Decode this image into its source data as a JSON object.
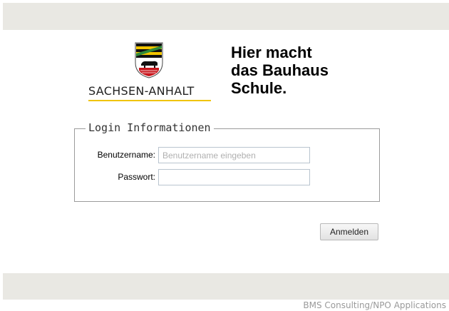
{
  "header": {},
  "logo": {
    "state_name": "SACHSEN-ANHALT",
    "slogan_lines": [
      "Hier macht",
      "das Bauhaus",
      "Schule."
    ]
  },
  "login": {
    "legend": "Login Informationen",
    "username_label": "Benutzername:",
    "username_placeholder": "Benutzername eingeben",
    "username_value": "",
    "password_label": "Passwort:",
    "password_value": "",
    "submit_label": "Anmelden"
  },
  "footer": {
    "credit": "BMS Consulting/NPO Applications"
  },
  "colors": {
    "bar_background": "#e9e8e3",
    "logo_accent": "#f0c400",
    "coat_green": "#2f8a3a",
    "coat_black": "#000000",
    "coat_red": "#c8161d"
  },
  "icons": {
    "coat_of_arms": "coat-of-arms-icon"
  }
}
